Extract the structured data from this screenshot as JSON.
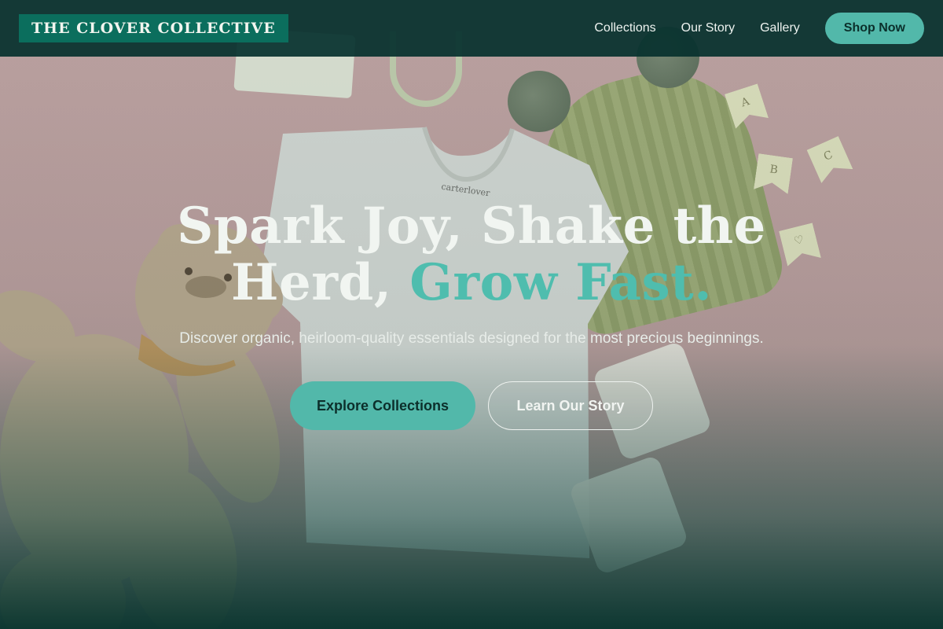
{
  "brand": {
    "logo_text": "THE CLOVER COLLECTIVE"
  },
  "nav": {
    "links": [
      "Collections",
      "Our Story",
      "Gallery"
    ],
    "cta": "Shop Now"
  },
  "hero": {
    "headline_line1": "Spark Joy, Shake the",
    "headline_line2_start": "Herd, ",
    "headline_accent": "Grow Fast.",
    "subtitle": "Discover organic, heirloom-quality essentials designed for the most precious beginnings.",
    "primary_cta": "Explore Collections",
    "secondary_cta": "Learn Our Story",
    "background_image_text": {
      "shirt_label": "carterlover",
      "pennants": [
        "A",
        "B",
        "C",
        "♡"
      ]
    }
  },
  "colors": {
    "nav_bg": "#08322e",
    "logo_bg": "#0b6e5d",
    "accent": "#52b8aa",
    "text_light": "#f1f5f1"
  }
}
